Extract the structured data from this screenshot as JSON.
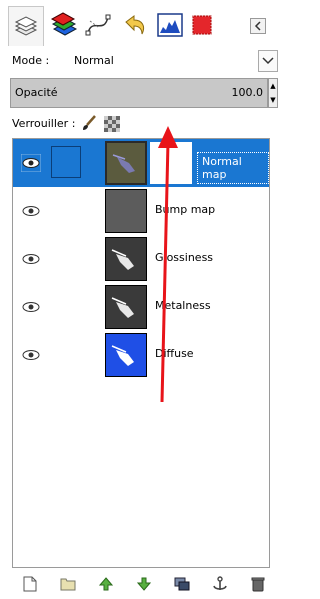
{
  "tabs": [
    {
      "icon": "layers-icon",
      "active": true
    },
    {
      "icon": "channels-icon",
      "active": false
    },
    {
      "icon": "paths-icon",
      "active": false
    },
    {
      "icon": "undo-history-icon",
      "active": false
    },
    {
      "icon": "histogram-icon",
      "active": false
    },
    {
      "icon": "colors-icon",
      "active": false
    }
  ],
  "mode": {
    "label": "Mode :",
    "value": "Normal"
  },
  "opacity": {
    "label": "Opacité",
    "value": "100.0"
  },
  "lock": {
    "label": "Verrouiller :"
  },
  "layers": [
    {
      "name": "Normal map",
      "selected": true,
      "visible": true,
      "thumb_color": "#5b5b3e",
      "has_mask": true
    },
    {
      "name": "Bump map",
      "selected": false,
      "visible": true,
      "thumb_color": "#5c5c5c",
      "has_mask": false
    },
    {
      "name": "Glossiness",
      "selected": false,
      "visible": true,
      "thumb_color": "#3a3a3a",
      "has_mask": false
    },
    {
      "name": "Metalness",
      "selected": false,
      "visible": true,
      "thumb_color": "#3a3a3a",
      "has_mask": false
    },
    {
      "name": "Diffuse",
      "selected": false,
      "visible": true,
      "thumb_color": "#1f4fe6",
      "has_mask": false
    }
  ],
  "bottom_buttons": [
    "new-layer-icon",
    "new-group-icon",
    "raise-layer-icon",
    "lower-layer-icon",
    "duplicate-layer-icon",
    "anchor-layer-icon",
    "delete-layer-icon"
  ],
  "colors": {
    "selection": "#1a77d2",
    "annotation": "#e8141a"
  }
}
